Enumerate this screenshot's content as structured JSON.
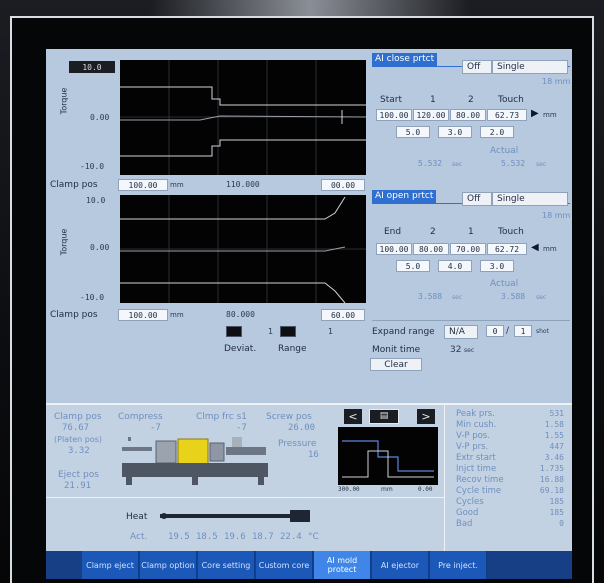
{
  "torque_plot": {
    "y_label": "Torque",
    "y_max": "10.0",
    "y_mid": "0.00",
    "y_min": "-10.0"
  },
  "clamp_pos_row1": {
    "label": "Clamp pos",
    "left": "100.00",
    "left_unit": "mm",
    "mid": "110.000",
    "right": "00.00"
  },
  "open_plot": {
    "y_label": "Torque",
    "y_max": "10.0",
    "y_mid": "0.00",
    "y_min": "-10.0"
  },
  "clamp_pos_row2": {
    "label": "Clamp pos",
    "left": "100.00",
    "left_unit": "mm",
    "mid": "80.000",
    "right": "60.00"
  },
  "legend": {
    "deviat": "Deviat.",
    "range": "Range",
    "deviat_num": "1",
    "range_num": "1"
  },
  "close_protect": {
    "title": "AI close prtct",
    "mode": "Off",
    "mode2": "Single",
    "unit_top": "18 mm",
    "start_label": "Start",
    "col1": "1",
    "col2": "2",
    "touch": "Touch",
    "v1": "100.00",
    "v2": "120.00",
    "v3": "80.00",
    "touch_val": "62.73",
    "unit_row": "mm",
    "r2a": "5.0",
    "r2b": "3.0",
    "r2c": "2.0",
    "actual": "Actual",
    "actual_left": "5.532",
    "actual_right": "5.532",
    "actual_unit": "sec"
  },
  "open_protect": {
    "title": "AI open prtct",
    "mode": "Off",
    "mode2": "Single",
    "unit_top": "18 mm",
    "end_label": "End",
    "col1": "2",
    "col2": "1",
    "touch": "Touch",
    "v1": "100.00",
    "v2": "80.00",
    "v3": "70.00",
    "touch_val": "62.72",
    "unit_row": "mm",
    "r2a": "5.0",
    "r2b": "4.0",
    "r2c": "3.0",
    "actual": "Actual",
    "actual_left": "3.588",
    "actual_right": "3.588",
    "actual_unit": "sec"
  },
  "expand": {
    "label": "Expand range",
    "value": "N/A",
    "a": "0",
    "b": "1",
    "unit": "shot",
    "monit_label": "Monit time",
    "monit_val": "32",
    "monit_unit": "sec",
    "clear": "Clear"
  },
  "machine": {
    "clamp_pos_label": "Clamp pos",
    "clamp_pos_val": "76.67",
    "platen_label": "(Platen pos)",
    "platen_val": "3.32",
    "eject_label": "Eject pos",
    "eject_val": "21.91",
    "compress_label": "Compress",
    "compress_val": "-7",
    "clmp_frc_label": "Clmp frc s1",
    "clmp_frc_val": "-7",
    "screw_label": "Screw pos",
    "screw_val": "26.00",
    "pressure_label": "Pressure",
    "pressure_val": "16"
  },
  "heat": {
    "label": "Heat",
    "act_label": "Act.",
    "t1": "19.5",
    "t2": "18.5",
    "t3": "19.6",
    "t4": "18.7",
    "t5": "22.4",
    "unit": "°C"
  },
  "mini_chart": {
    "x0": "300.00",
    "x1": "mm",
    "x2": "0.00",
    "prev": "<",
    "next": ">"
  },
  "stats": [
    {
      "label": "Peak prs.",
      "value": "531"
    },
    {
      "label": "Min cush.",
      "value": "1.58"
    },
    {
      "label": "V-P pos.",
      "value": "1.55"
    },
    {
      "label": "V-P prs.",
      "value": "447"
    },
    {
      "label": "Extr start",
      "value": "3.46"
    },
    {
      "label": "Injct time",
      "value": "1.735"
    },
    {
      "label": "Recov time",
      "value": "16.88"
    },
    {
      "label": "Cycle time",
      "value": "69.18"
    },
    {
      "label": "Cycles",
      "value": "185"
    },
    {
      "label": "Good",
      "value": "185"
    },
    {
      "label": "Bad",
      "value": "0"
    }
  ],
  "tabs": [
    {
      "label": "Clamp eject"
    },
    {
      "label": "Clamp option"
    },
    {
      "label": "Core setting"
    },
    {
      "label": "Custom core"
    },
    {
      "label": "AI mold protect"
    },
    {
      "label": "AI ejector"
    },
    {
      "label": "Pre inject."
    }
  ],
  "colors": {
    "screen_bg": "#b7c9de",
    "active_tab": "#3f86e8",
    "tab": "#1c58b8",
    "plot_bg": "#030303",
    "header_blue": "#2f6fd0"
  }
}
